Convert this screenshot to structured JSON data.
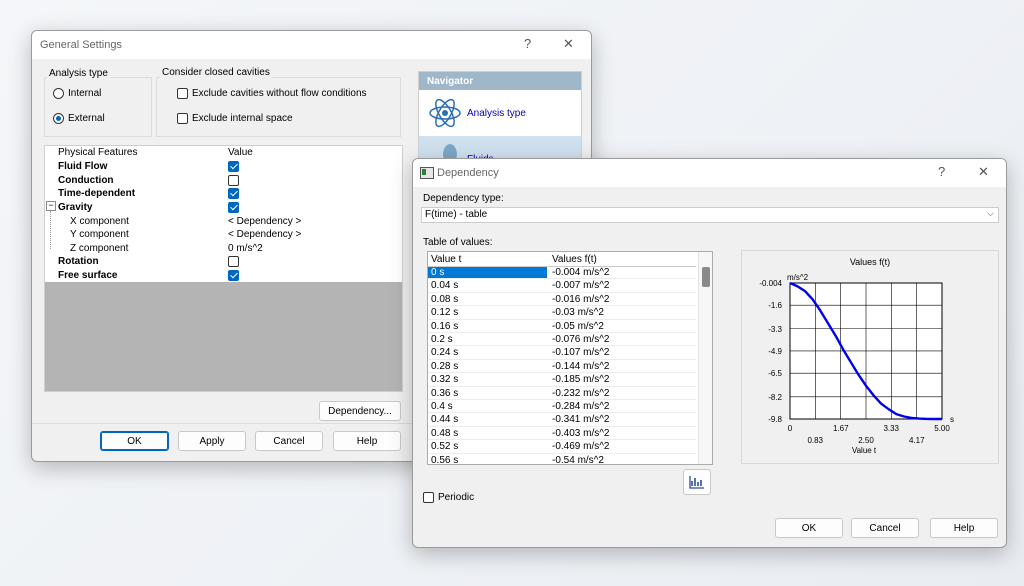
{
  "general": {
    "title": "General Settings",
    "help": "?",
    "close": "✕",
    "analysis_type_label": "Analysis type",
    "internal": "Internal",
    "external": "External",
    "cavities_label": "Consider closed cavities",
    "exclude_cavities": "Exclude cavities without flow conditions",
    "exclude_internal": "Exclude internal space",
    "grid_header_feature": "Physical Features",
    "grid_header_value": "Value",
    "rows": [
      {
        "label": "Fluid Flow",
        "value": ""
      },
      {
        "label": "Conduction",
        "value": ""
      },
      {
        "label": "Time-dependent",
        "value": ""
      },
      {
        "label": "Gravity",
        "value": ""
      },
      {
        "label": "X component",
        "value": "< Dependency >"
      },
      {
        "label": "Y component",
        "value": "< Dependency >"
      },
      {
        "label": "Z component",
        "value": "0 m/s^2"
      },
      {
        "label": "Rotation",
        "value": ""
      },
      {
        "label": "Free surface",
        "value": ""
      }
    ],
    "tree_toggle": "−",
    "dependency_button": "Dependency...",
    "ok": "OK",
    "apply": "Apply",
    "cancel": "Cancel",
    "helpbtn": "Help",
    "navigator": {
      "title": "Navigator",
      "item1": "Analysis type",
      "item2": "Fluids"
    }
  },
  "dependency": {
    "title": "Dependency",
    "help": "?",
    "close": "✕",
    "type_label": "Dependency type:",
    "type_value": "F(time) - table",
    "table_label": "Table of values:",
    "col_t": "Value t",
    "col_f": "Values f(t)",
    "rows": [
      [
        "0 s",
        "-0.004 m/s^2"
      ],
      [
        "0.04 s",
        "-0.007 m/s^2"
      ],
      [
        "0.08 s",
        "-0.016 m/s^2"
      ],
      [
        "0.12 s",
        "-0.03 m/s^2"
      ],
      [
        "0.16 s",
        "-0.05 m/s^2"
      ],
      [
        "0.2 s",
        "-0.076 m/s^2"
      ],
      [
        "0.24 s",
        "-0.107 m/s^2"
      ],
      [
        "0.28 s",
        "-0.144 m/s^2"
      ],
      [
        "0.32 s",
        "-0.185 m/s^2"
      ],
      [
        "0.36 s",
        "-0.232 m/s^2"
      ],
      [
        "0.4 s",
        "-0.284 m/s^2"
      ],
      [
        "0.44 s",
        "-0.341 m/s^2"
      ],
      [
        "0.48 s",
        "-0.403 m/s^2"
      ],
      [
        "0.52 s",
        "-0.469 m/s^2"
      ],
      [
        "0.56 s",
        "-0.54 m/s^2"
      ]
    ],
    "periodic": "Periodic",
    "ok": "OK",
    "cancel": "Cancel",
    "helpbtn": "Help",
    "accent": "#0067c0"
  },
  "chart_data": {
    "type": "line",
    "title": "Values f(t)",
    "xlabel": "Value t",
    "ylabel": "m/s^2",
    "x_unit": "s",
    "xlim": [
      0,
      5
    ],
    "ylim": [
      -9.8,
      -0.004
    ],
    "x_ticks_top": [
      "0",
      "1.67",
      "3.33",
      "5.00"
    ],
    "x_ticks_bottom": [
      "0.83",
      "2.50",
      "4.17"
    ],
    "x_tick_values_top": [
      0,
      1.67,
      3.33,
      5.0
    ],
    "x_tick_values_bottom": [
      0.83,
      2.5,
      4.17
    ],
    "y_ticks": [
      "-0.004",
      "-1.6",
      "-3.3",
      "-4.9",
      "-6.5",
      "-8.2",
      "-9.8"
    ],
    "y_tick_values": [
      -0.004,
      -1.6,
      -3.3,
      -4.9,
      -6.5,
      -8.2,
      -9.8
    ],
    "grid": true,
    "series": [
      {
        "color": "#0000ee",
        "x": [
          0,
          0.25,
          0.5,
          0.75,
          1.0,
          1.25,
          1.5,
          1.75,
          2.0,
          2.25,
          2.5,
          2.75,
          3.0,
          3.25,
          3.5,
          3.75,
          4.0,
          4.25,
          4.5,
          4.75,
          5.0
        ],
        "y": [
          -0.004,
          -0.25,
          -0.6,
          -1.2,
          -2.0,
          -2.9,
          -3.8,
          -4.8,
          -5.7,
          -6.6,
          -7.4,
          -8.1,
          -8.7,
          -9.1,
          -9.45,
          -9.62,
          -9.72,
          -9.77,
          -9.79,
          -9.8,
          -9.8
        ]
      }
    ]
  }
}
